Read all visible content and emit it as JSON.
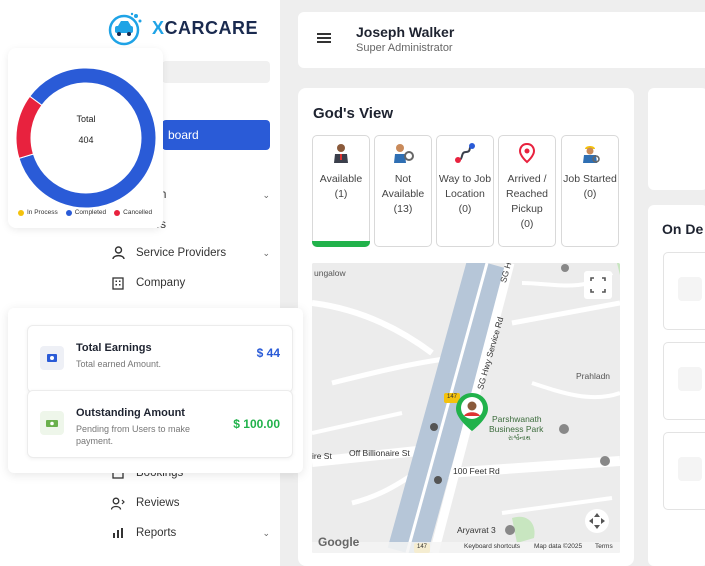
{
  "brand": {
    "name_prefix": "X",
    "name_rest": "CARCARE"
  },
  "header": {
    "user_name": "Joseph Walker",
    "user_role": "Super Administrator"
  },
  "sidebar": {
    "active_label": "board",
    "items": [
      {
        "label": "n",
        "icon": "menu-item-icon",
        "chevron": true
      },
      {
        "label": "Users",
        "icon": "users-icon",
        "chevron": false
      },
      {
        "label": "Service Providers",
        "icon": "user-icon",
        "chevron": true
      },
      {
        "label": "Company",
        "icon": "building-icon",
        "chevron": false
      },
      {
        "label": "Bookings",
        "icon": "calendar-icon",
        "chevron": false
      },
      {
        "label": "Reviews",
        "icon": "reviews-icon",
        "chevron": false
      },
      {
        "label": "Reports",
        "icon": "bar-chart-icon",
        "chevron": true
      }
    ]
  },
  "donut": {
    "total_label": "Total",
    "total_value": "404",
    "legend": [
      {
        "label": "In Process",
        "color": "#f4c20d"
      },
      {
        "label": "Completed",
        "color": "#2a5bd7"
      },
      {
        "label": "Cancelled",
        "color": "#e8223e"
      }
    ]
  },
  "chart_data": {
    "type": "pie",
    "categories": [
      "In Process",
      "Completed",
      "Cancelled"
    ],
    "values": [
      0,
      344,
      60
    ],
    "colors": [
      "#f4c20d",
      "#2a5bd7",
      "#e8223e"
    ],
    "title": ""
  },
  "earnings": {
    "total": {
      "title": "Total Earnings",
      "subtitle": "Total earned Amount.",
      "value": "$ 44",
      "color": "#2a5bd7"
    },
    "outstanding": {
      "title": "Outstanding Amount",
      "subtitle": "Pending from Users to make payment.",
      "value": "$ 100.00",
      "color": "#21b24b"
    }
  },
  "gods_view": {
    "title": "God's View",
    "stats": [
      {
        "label": "Available",
        "count": "(1)",
        "active": true,
        "icon": "driver-icon"
      },
      {
        "label": "Not Available",
        "count": "(13)",
        "active": false,
        "icon": "mechanic-icon"
      },
      {
        "label": "Way to Job Location",
        "count": "(0)",
        "active": false,
        "icon": "route-icon"
      },
      {
        "label": "Arrived / Reached Pickup",
        "count": "(0)",
        "active": false,
        "icon": "location-pin-icon"
      },
      {
        "label": "Job Started",
        "count": "(0)",
        "active": false,
        "icon": "worker-icon"
      }
    ]
  },
  "map": {
    "labels": {
      "bungalow": "ungalow",
      "sg_hwy": "SG Hwy",
      "sg_hwy_service": "SG Hwy Service Rd",
      "prahladn": "Prahladn",
      "parshwanath": "Parshwanath",
      "business_park": "Business Park",
      "business_park_sub": "રાર્શ્વનાથ",
      "off_billionaire": "Off Billionaire St",
      "ire_st": "ire St",
      "hundred_feet": "100 Feet Rd",
      "aryavrat": "Aryavrat 3",
      "road_147a": "147",
      "road_147b": "147",
      "google": "Google",
      "shortcuts": "Keyboard shortcuts",
      "mapdata": "Map data ©2025",
      "terms": "Terms"
    }
  },
  "right_panel": {
    "title": "On De"
  }
}
